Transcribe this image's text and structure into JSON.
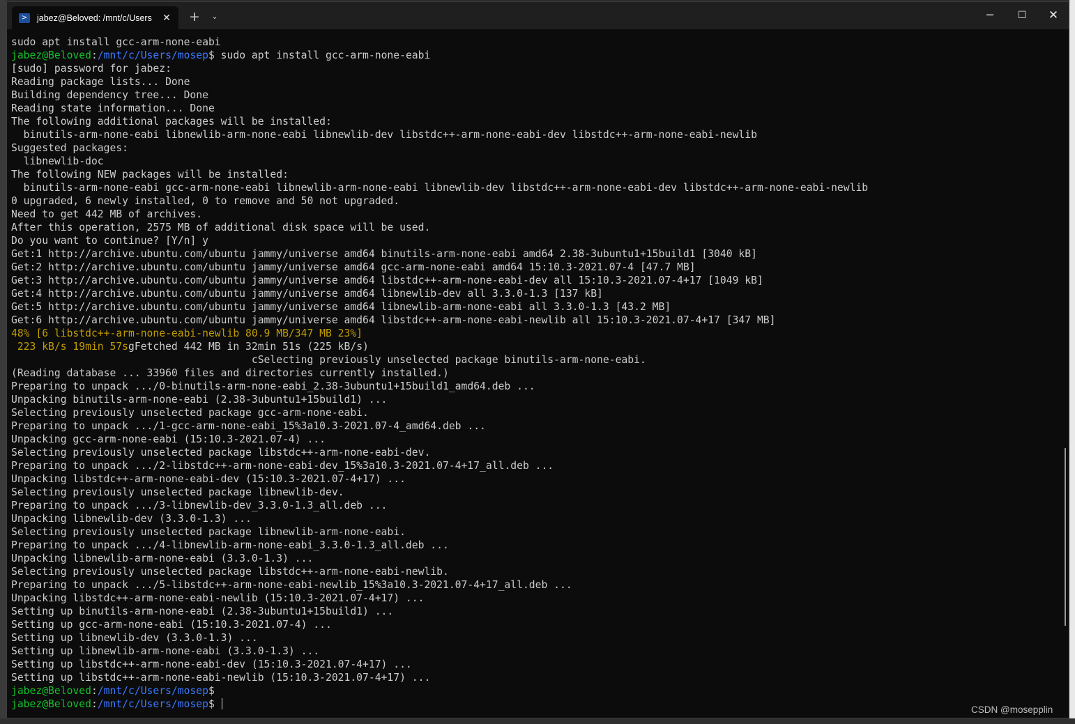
{
  "window": {
    "tab_title": "jabez@Beloved: /mnt/c/Users",
    "tab_icon": "powershell-icon",
    "tab_close_glyph": "✕",
    "new_tab_glyph": "+",
    "dropdown_glyph": "⌄",
    "minimize_glyph": "─",
    "maximize_glyph": "☐",
    "close_glyph": "✕"
  },
  "prompt": {
    "user_host": "jabez@Beloved",
    "sep": ":",
    "path": "/mnt/c/Users/mosep",
    "symbol": "$"
  },
  "colors": {
    "prompt_user": "#13c12a",
    "prompt_path": "#3b78ff",
    "progress": "#c19c00",
    "text": "#cccccc",
    "background": "#0c0c0c"
  },
  "terminal": {
    "lines": [
      [
        {
          "t": "sudo apt install gcc-arm-none-eabi",
          "c": "plain"
        }
      ],
      [
        {
          "t": "jabez@Beloved",
          "c": "green"
        },
        {
          "t": ":",
          "c": "plain"
        },
        {
          "t": "/mnt/c/Users/mosep",
          "c": "blue"
        },
        {
          "t": "$ sudo apt install gcc-arm-none-eabi",
          "c": "plain"
        }
      ],
      [
        {
          "t": "[sudo] password for jabez:",
          "c": "plain"
        }
      ],
      [
        {
          "t": "Reading package lists... Done",
          "c": "plain"
        }
      ],
      [
        {
          "t": "Building dependency tree... Done",
          "c": "plain"
        }
      ],
      [
        {
          "t": "Reading state information... Done",
          "c": "plain"
        }
      ],
      [
        {
          "t": "The following additional packages will be installed:",
          "c": "plain"
        }
      ],
      [
        {
          "t": "  binutils-arm-none-eabi libnewlib-arm-none-eabi libnewlib-dev libstdc++-arm-none-eabi-dev libstdc++-arm-none-eabi-newlib",
          "c": "plain"
        }
      ],
      [
        {
          "t": "Suggested packages:",
          "c": "plain"
        }
      ],
      [
        {
          "t": "  libnewlib-doc",
          "c": "plain"
        }
      ],
      [
        {
          "t": "The following NEW packages will be installed:",
          "c": "plain"
        }
      ],
      [
        {
          "t": "  binutils-arm-none-eabi gcc-arm-none-eabi libnewlib-arm-none-eabi libnewlib-dev libstdc++-arm-none-eabi-dev libstdc++-arm-none-eabi-newlib",
          "c": "plain"
        }
      ],
      [
        {
          "t": "0 upgraded, 6 newly installed, 0 to remove and 50 not upgraded.",
          "c": "plain"
        }
      ],
      [
        {
          "t": "Need to get 442 MB of archives.",
          "c": "plain"
        }
      ],
      [
        {
          "t": "After this operation, 2575 MB of additional disk space will be used.",
          "c": "plain"
        }
      ],
      [
        {
          "t": "Do you want to continue? [Y/n] y",
          "c": "plain"
        }
      ],
      [
        {
          "t": "Get:1 http://archive.ubuntu.com/ubuntu jammy/universe amd64 binutils-arm-none-eabi amd64 2.38-3ubuntu1+15build1 [3040 kB]",
          "c": "plain"
        }
      ],
      [
        {
          "t": "Get:2 http://archive.ubuntu.com/ubuntu jammy/universe amd64 gcc-arm-none-eabi amd64 15:10.3-2021.07-4 [47.7 MB]",
          "c": "plain"
        }
      ],
      [
        {
          "t": "Get:3 http://archive.ubuntu.com/ubuntu jammy/universe amd64 libstdc++-arm-none-eabi-dev all 15:10.3-2021.07-4+17 [1049 kB]",
          "c": "plain"
        }
      ],
      [
        {
          "t": "Get:4 http://archive.ubuntu.com/ubuntu jammy/universe amd64 libnewlib-dev all 3.3.0-1.3 [137 kB]",
          "c": "plain"
        }
      ],
      [
        {
          "t": "Get:5 http://archive.ubuntu.com/ubuntu jammy/universe amd64 libnewlib-arm-none-eabi all 3.3.0-1.3 [43.2 MB]",
          "c": "plain"
        }
      ],
      [
        {
          "t": "Get:6 http://archive.ubuntu.com/ubuntu jammy/universe amd64 libstdc++-arm-none-eabi-newlib all 15:10.3-2021.07-4+17 [347 MB]",
          "c": "plain"
        }
      ],
      [
        {
          "t": "48% [6 libstdc++-arm-none-eabi-newlib 80.9 MB/347 MB 23%]",
          "c": "yellow"
        }
      ],
      [
        {
          "t": " 223 kB/s 19min 57s",
          "c": "yellow"
        },
        {
          "t": "gFetched 442 MB in 32min 51s (225 kB/s)",
          "c": "plain"
        }
      ],
      [
        {
          "t": "                                       cSelecting previously unselected package binutils-arm-none-eabi.",
          "c": "plain"
        }
      ],
      [
        {
          "t": "(Reading database ... 33960 files and directories currently installed.)",
          "c": "plain"
        }
      ],
      [
        {
          "t": "Preparing to unpack .../0-binutils-arm-none-eabi_2.38-3ubuntu1+15build1_amd64.deb ...",
          "c": "plain"
        }
      ],
      [
        {
          "t": "Unpacking binutils-arm-none-eabi (2.38-3ubuntu1+15build1) ...",
          "c": "plain"
        }
      ],
      [
        {
          "t": "Selecting previously unselected package gcc-arm-none-eabi.",
          "c": "plain"
        }
      ],
      [
        {
          "t": "Preparing to unpack .../1-gcc-arm-none-eabi_15%3a10.3-2021.07-4_amd64.deb ...",
          "c": "plain"
        }
      ],
      [
        {
          "t": "Unpacking gcc-arm-none-eabi (15:10.3-2021.07-4) ...",
          "c": "plain"
        }
      ],
      [
        {
          "t": "Selecting previously unselected package libstdc++-arm-none-eabi-dev.",
          "c": "plain"
        }
      ],
      [
        {
          "t": "Preparing to unpack .../2-libstdc++-arm-none-eabi-dev_15%3a10.3-2021.07-4+17_all.deb ...",
          "c": "plain"
        }
      ],
      [
        {
          "t": "Unpacking libstdc++-arm-none-eabi-dev (15:10.3-2021.07-4+17) ...",
          "c": "plain"
        }
      ],
      [
        {
          "t": "Selecting previously unselected package libnewlib-dev.",
          "c": "plain"
        }
      ],
      [
        {
          "t": "Preparing to unpack .../3-libnewlib-dev_3.3.0-1.3_all.deb ...",
          "c": "plain"
        }
      ],
      [
        {
          "t": "Unpacking libnewlib-dev (3.3.0-1.3) ...",
          "c": "plain"
        }
      ],
      [
        {
          "t": "Selecting previously unselected package libnewlib-arm-none-eabi.",
          "c": "plain"
        }
      ],
      [
        {
          "t": "Preparing to unpack .../4-libnewlib-arm-none-eabi_3.3.0-1.3_all.deb ...",
          "c": "plain"
        }
      ],
      [
        {
          "t": "Unpacking libnewlib-arm-none-eabi (3.3.0-1.3) ...",
          "c": "plain"
        }
      ],
      [
        {
          "t": "Selecting previously unselected package libstdc++-arm-none-eabi-newlib.",
          "c": "plain"
        }
      ],
      [
        {
          "t": "Preparing to unpack .../5-libstdc++-arm-none-eabi-newlib_15%3a10.3-2021.07-4+17_all.deb ...",
          "c": "plain"
        }
      ],
      [
        {
          "t": "Unpacking libstdc++-arm-none-eabi-newlib (15:10.3-2021.07-4+17) ...",
          "c": "plain"
        }
      ],
      [
        {
          "t": "Setting up binutils-arm-none-eabi (2.38-3ubuntu1+15build1) ...",
          "c": "plain"
        }
      ],
      [
        {
          "t": "Setting up gcc-arm-none-eabi (15:10.3-2021.07-4) ...",
          "c": "plain"
        }
      ],
      [
        {
          "t": "Setting up libnewlib-dev (3.3.0-1.3) ...",
          "c": "plain"
        }
      ],
      [
        {
          "t": "Setting up libnewlib-arm-none-eabi (3.3.0-1.3) ...",
          "c": "plain"
        }
      ],
      [
        {
          "t": "Setting up libstdc++-arm-none-eabi-dev (15:10.3-2021.07-4+17) ...",
          "c": "plain"
        }
      ],
      [
        {
          "t": "Setting up libstdc++-arm-none-eabi-newlib (15:10.3-2021.07-4+17) ...",
          "c": "plain"
        }
      ],
      [
        {
          "t": "jabez@Beloved",
          "c": "green"
        },
        {
          "t": ":",
          "c": "plain"
        },
        {
          "t": "/mnt/c/Users/mosep",
          "c": "blue"
        },
        {
          "t": "$",
          "c": "plain"
        }
      ],
      [
        {
          "t": "jabez@Beloved",
          "c": "green"
        },
        {
          "t": ":",
          "c": "plain"
        },
        {
          "t": "/mnt/c/Users/mosep",
          "c": "blue"
        },
        {
          "t": "$ ",
          "c": "plain"
        }
      ]
    ]
  },
  "watermark": "CSDN @mosepplin"
}
